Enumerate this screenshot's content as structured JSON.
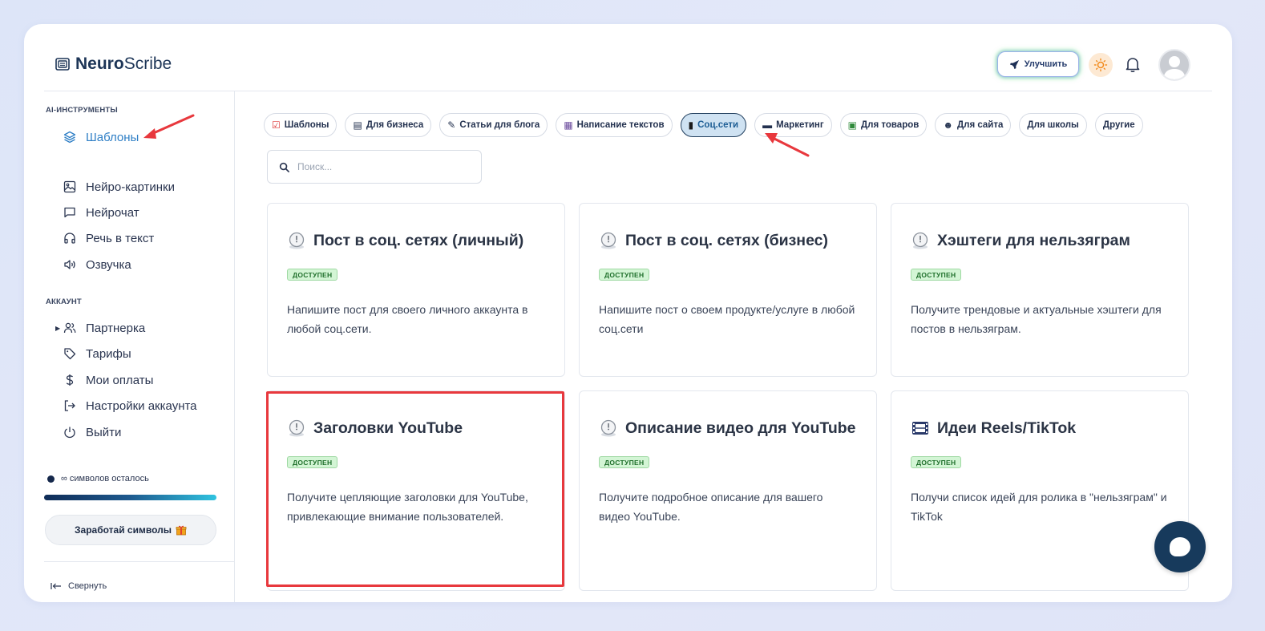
{
  "app": {
    "logo_bold": "Neuro",
    "logo_rest": "Scribe"
  },
  "header": {
    "upgrade_label": "Улучшить"
  },
  "sidebar": {
    "ai_section": "AI-ИНСТРУМЕНТЫ",
    "ai_items": [
      {
        "label": "Шаблоны",
        "icon": "layers-icon",
        "active": true
      },
      {
        "label": "Нейро-картинки",
        "icon": "image-icon"
      },
      {
        "label": "Нейрочат",
        "icon": "chat-icon"
      },
      {
        "label": "Речь в текст",
        "icon": "headphones-icon"
      },
      {
        "label": "Озвучка",
        "icon": "speaker-icon"
      }
    ],
    "account_section": "АККАУНТ",
    "account_items": [
      {
        "label": "Партнерка",
        "icon": "users-icon"
      },
      {
        "label": "Тарифы",
        "icon": "tag-icon"
      },
      {
        "label": "Мои оплаты",
        "icon": "dollar-icon"
      },
      {
        "label": "Настройки аккаунта",
        "icon": "logout-arrow-icon"
      },
      {
        "label": "Выйти",
        "icon": "power-icon"
      }
    ],
    "symbols_left": "∞ символов осталось",
    "earn_label": "Заработай символы",
    "collapse_label": "Свернуть"
  },
  "tabs": [
    {
      "icon": "☑",
      "label": "Шаблоны"
    },
    {
      "icon": "▤",
      "label": "Для бизнеса"
    },
    {
      "icon": "✎",
      "label": "Статьи для блога"
    },
    {
      "icon": "▦",
      "label": "Написание текстов"
    },
    {
      "icon": "▮",
      "label": "Соц.сети",
      "active": true
    },
    {
      "icon": "▬",
      "label": "Маркетинг"
    },
    {
      "icon": "▣",
      "label": "Для товаров"
    },
    {
      "icon": "☻",
      "label": "Для сайта"
    },
    {
      "icon": "",
      "label": "Для школы"
    },
    {
      "icon": "",
      "label": "Другие"
    }
  ],
  "search": {
    "placeholder": "Поиск..."
  },
  "cards": [
    {
      "title": "Пост в соц. сетях (личный)",
      "badge": "ДОСТУПЕН",
      "desc": "Напишите пост для своего личного аккаунта в любой соц.сети.",
      "icon": "clock-icon"
    },
    {
      "title": "Пост в соц. сетях (бизнес)",
      "badge": "ДОСТУПЕН",
      "desc": "Напишите пост о своем продукте/услуге в любой соц.сети",
      "icon": "clock-icon"
    },
    {
      "title": "Хэштеги для нельзяграм",
      "badge": "ДОСТУПЕН",
      "desc": "Получите трендовые и актуальные хэштеги для постов в нельзяграм.",
      "icon": "clock-icon"
    },
    {
      "title": "Заголовки YouTube",
      "badge": "ДОСТУПЕН",
      "desc": "Получите цепляющие заголовки для YouTube, привлекающие внимание пользователей.",
      "icon": "clock-icon"
    },
    {
      "title": "Описание видео для YouTube",
      "badge": "ДОСТУПЕН",
      "desc": "Получите подробное описание для вашего видео YouTube.",
      "icon": "clock-icon"
    },
    {
      "title": "Идеи Reels/TikTok",
      "badge": "ДОСТУПЕН",
      "desc": "Получи список идей для ролика в \"нельзяграм\" и TikTok",
      "icon": "film-icon"
    }
  ],
  "colors": {
    "accent": "#2f7fc6",
    "annotation_red": "#e8383d",
    "badge_green": "#d3f5d5",
    "dark_navy": "#173a5c"
  }
}
